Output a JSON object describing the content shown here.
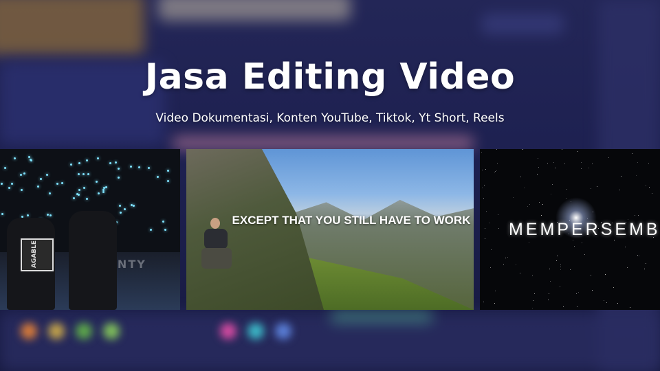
{
  "header": {
    "title": "Jasa Editing Video",
    "subtitle": "Video Dokumentasi, Konten YouTube, Tiktok, Yt Short, Reels"
  },
  "thumbnails": [
    {
      "name": "concert",
      "overlay_text": "ENTY",
      "sign_text": "AGABLE"
    },
    {
      "name": "mountain",
      "caption": "EXCEPT THAT YOU STILL HAVE TO WORK"
    },
    {
      "name": "space",
      "overlay_text": "MEMPERSEMB"
    }
  ],
  "colors": {
    "background": "#1c1f4a",
    "title_text": "#ffffff",
    "caption_text": "#ffffff"
  }
}
